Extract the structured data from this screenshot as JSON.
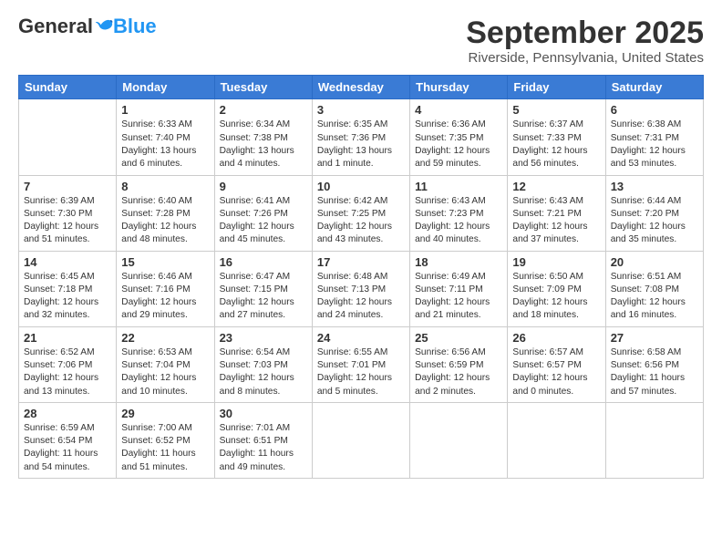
{
  "header": {
    "logo_general": "General",
    "logo_blue": "Blue",
    "month_title": "September 2025",
    "location": "Riverside, Pennsylvania, United States"
  },
  "days_of_week": [
    "Sunday",
    "Monday",
    "Tuesday",
    "Wednesday",
    "Thursday",
    "Friday",
    "Saturday"
  ],
  "weeks": [
    [
      {
        "day": "",
        "data": ""
      },
      {
        "day": "1",
        "data": "Sunrise: 6:33 AM\nSunset: 7:40 PM\nDaylight: 13 hours\nand 6 minutes."
      },
      {
        "day": "2",
        "data": "Sunrise: 6:34 AM\nSunset: 7:38 PM\nDaylight: 13 hours\nand 4 minutes."
      },
      {
        "day": "3",
        "data": "Sunrise: 6:35 AM\nSunset: 7:36 PM\nDaylight: 13 hours\nand 1 minute."
      },
      {
        "day": "4",
        "data": "Sunrise: 6:36 AM\nSunset: 7:35 PM\nDaylight: 12 hours\nand 59 minutes."
      },
      {
        "day": "5",
        "data": "Sunrise: 6:37 AM\nSunset: 7:33 PM\nDaylight: 12 hours\nand 56 minutes."
      },
      {
        "day": "6",
        "data": "Sunrise: 6:38 AM\nSunset: 7:31 PM\nDaylight: 12 hours\nand 53 minutes."
      }
    ],
    [
      {
        "day": "7",
        "data": "Sunrise: 6:39 AM\nSunset: 7:30 PM\nDaylight: 12 hours\nand 51 minutes."
      },
      {
        "day": "8",
        "data": "Sunrise: 6:40 AM\nSunset: 7:28 PM\nDaylight: 12 hours\nand 48 minutes."
      },
      {
        "day": "9",
        "data": "Sunrise: 6:41 AM\nSunset: 7:26 PM\nDaylight: 12 hours\nand 45 minutes."
      },
      {
        "day": "10",
        "data": "Sunrise: 6:42 AM\nSunset: 7:25 PM\nDaylight: 12 hours\nand 43 minutes."
      },
      {
        "day": "11",
        "data": "Sunrise: 6:43 AM\nSunset: 7:23 PM\nDaylight: 12 hours\nand 40 minutes."
      },
      {
        "day": "12",
        "data": "Sunrise: 6:43 AM\nSunset: 7:21 PM\nDaylight: 12 hours\nand 37 minutes."
      },
      {
        "day": "13",
        "data": "Sunrise: 6:44 AM\nSunset: 7:20 PM\nDaylight: 12 hours\nand 35 minutes."
      }
    ],
    [
      {
        "day": "14",
        "data": "Sunrise: 6:45 AM\nSunset: 7:18 PM\nDaylight: 12 hours\nand 32 minutes."
      },
      {
        "day": "15",
        "data": "Sunrise: 6:46 AM\nSunset: 7:16 PM\nDaylight: 12 hours\nand 29 minutes."
      },
      {
        "day": "16",
        "data": "Sunrise: 6:47 AM\nSunset: 7:15 PM\nDaylight: 12 hours\nand 27 minutes."
      },
      {
        "day": "17",
        "data": "Sunrise: 6:48 AM\nSunset: 7:13 PM\nDaylight: 12 hours\nand 24 minutes."
      },
      {
        "day": "18",
        "data": "Sunrise: 6:49 AM\nSunset: 7:11 PM\nDaylight: 12 hours\nand 21 minutes."
      },
      {
        "day": "19",
        "data": "Sunrise: 6:50 AM\nSunset: 7:09 PM\nDaylight: 12 hours\nand 18 minutes."
      },
      {
        "day": "20",
        "data": "Sunrise: 6:51 AM\nSunset: 7:08 PM\nDaylight: 12 hours\nand 16 minutes."
      }
    ],
    [
      {
        "day": "21",
        "data": "Sunrise: 6:52 AM\nSunset: 7:06 PM\nDaylight: 12 hours\nand 13 minutes."
      },
      {
        "day": "22",
        "data": "Sunrise: 6:53 AM\nSunset: 7:04 PM\nDaylight: 12 hours\nand 10 minutes."
      },
      {
        "day": "23",
        "data": "Sunrise: 6:54 AM\nSunset: 7:03 PM\nDaylight: 12 hours\nand 8 minutes."
      },
      {
        "day": "24",
        "data": "Sunrise: 6:55 AM\nSunset: 7:01 PM\nDaylight: 12 hours\nand 5 minutes."
      },
      {
        "day": "25",
        "data": "Sunrise: 6:56 AM\nSunset: 6:59 PM\nDaylight: 12 hours\nand 2 minutes."
      },
      {
        "day": "26",
        "data": "Sunrise: 6:57 AM\nSunset: 6:57 PM\nDaylight: 12 hours\nand 0 minutes."
      },
      {
        "day": "27",
        "data": "Sunrise: 6:58 AM\nSunset: 6:56 PM\nDaylight: 11 hours\nand 57 minutes."
      }
    ],
    [
      {
        "day": "28",
        "data": "Sunrise: 6:59 AM\nSunset: 6:54 PM\nDaylight: 11 hours\nand 54 minutes."
      },
      {
        "day": "29",
        "data": "Sunrise: 7:00 AM\nSunset: 6:52 PM\nDaylight: 11 hours\nand 51 minutes."
      },
      {
        "day": "30",
        "data": "Sunrise: 7:01 AM\nSunset: 6:51 PM\nDaylight: 11 hours\nand 49 minutes."
      },
      {
        "day": "",
        "data": ""
      },
      {
        "day": "",
        "data": ""
      },
      {
        "day": "",
        "data": ""
      },
      {
        "day": "",
        "data": ""
      }
    ]
  ]
}
